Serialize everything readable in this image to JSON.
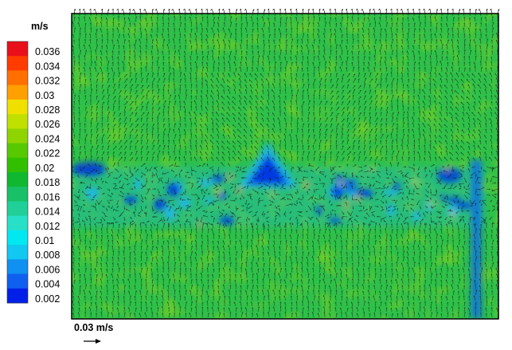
{
  "chart_data": {
    "type": "heatmap",
    "title": "",
    "xlabel": "",
    "ylabel": "",
    "colorbar": {
      "unit": "m/s",
      "ticks": [
        "0.036",
        "0.034",
        "0.032",
        "0.03",
        "0.028",
        "0.026",
        "0.024",
        "0.022",
        "0.02",
        "0.018",
        "0.016",
        "0.014",
        "0.012",
        "0.01",
        "0.008",
        "0.006",
        "0.004",
        "0.002"
      ],
      "colors": [
        "#e8101a",
        "#ff3c00",
        "#ff7000",
        "#ffa000",
        "#f0e000",
        "#c0e000",
        "#8fd400",
        "#58c800",
        "#30c000",
        "#10b830",
        "#18c068",
        "#20d098",
        "#28e0c8",
        "#00e8f0",
        "#10c8f0",
        "#1090f0",
        "#1060f0",
        "#0020e8"
      ],
      "range": [
        0.002,
        0.036
      ]
    },
    "background_color": "#2fc04a",
    "low_speed_color": "#0030e0",
    "reference_vector": {
      "label": "0.03 m/s",
      "value": 0.03
    },
    "legend_position": "left",
    "field_features": [
      {
        "description": "low velocity band",
        "x": [
          0.0,
          0.95
        ],
        "y": [
          0.55,
          0.68
        ]
      },
      {
        "description": "low velocity triangle",
        "x": [
          0.39,
          0.5
        ],
        "y": [
          0.45,
          0.58
        ]
      },
      {
        "description": "low velocity vertical strip",
        "x": [
          0.93,
          0.96
        ],
        "y": [
          0.5,
          1.0
        ]
      }
    ]
  }
}
